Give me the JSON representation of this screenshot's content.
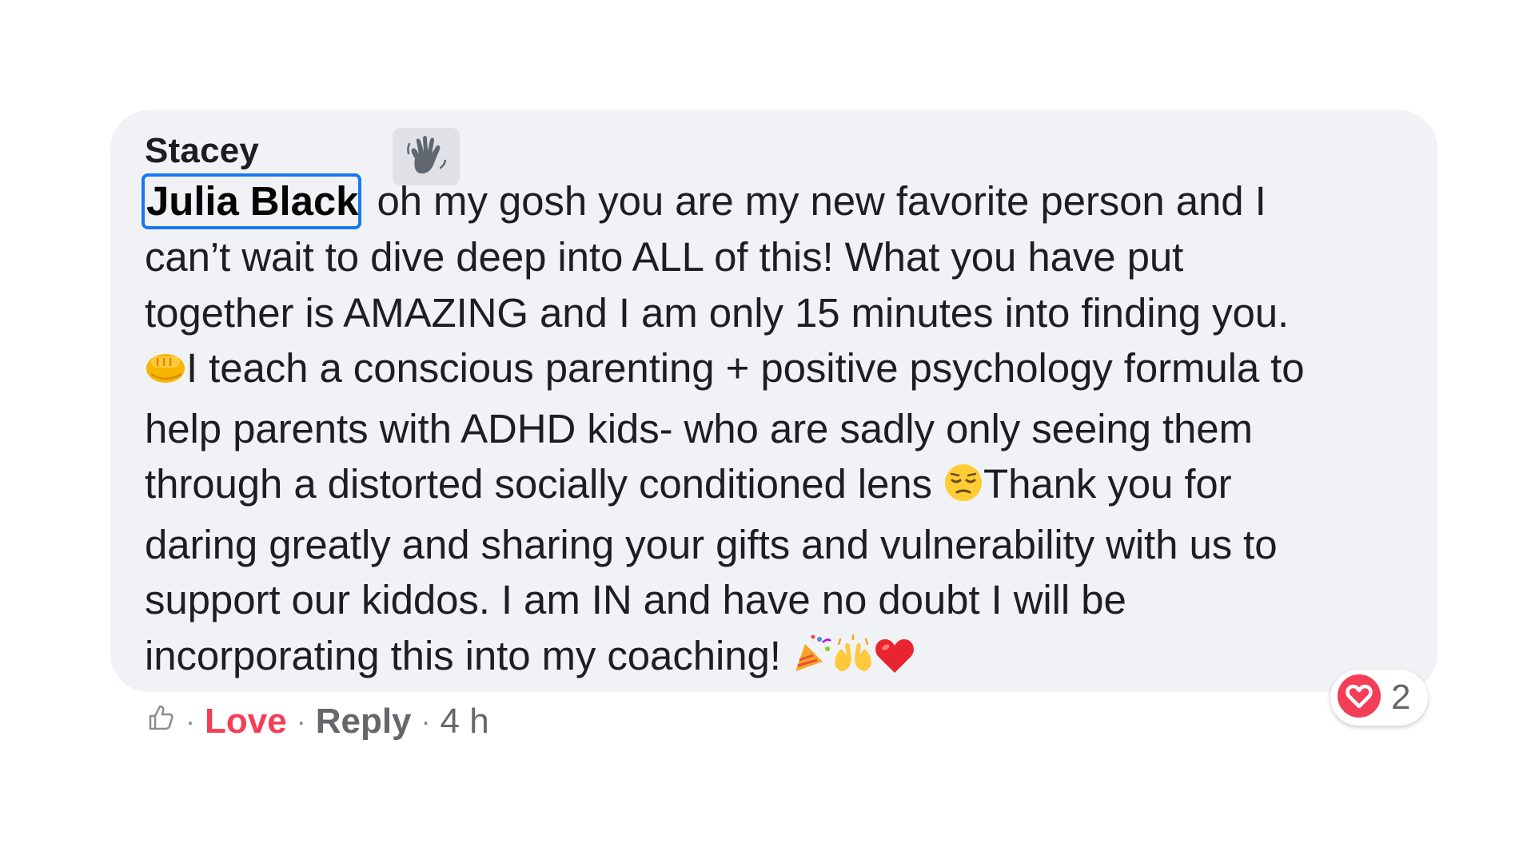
{
  "comment": {
    "author": "Stacey",
    "badge_icon": "wave-hand-icon",
    "mention": "Julia Black",
    "body_lines": [
      " oh my gosh you are my new favorite person and I",
      "can’t wait to dive deep into ALL of this! What you have put",
      "together is AMAZING and I am only 15 minutes into finding you.",
      "I teach a conscious parenting + positive psychology formula to",
      "help parents with ADHD kids- who are sadly only seeing them",
      "through a distorted socially conditioned lens ",
      "Thank you for",
      "daring greatly and sharing your gifts and vulnerability with us to",
      "support our kiddos. I am IN and have no doubt I will be",
      "incorporating this into my coaching! "
    ],
    "emojis": {
      "fist": "fist-bump-icon",
      "pensive": "pensive-face-icon",
      "party": "party-popper-icon",
      "raised_hands": "raised-hands-icon",
      "heart": "red-heart-icon"
    }
  },
  "actions": {
    "like_icon": "thumbs-up-outline-icon",
    "separator": "·",
    "love_label": "Love",
    "reply_label": "Reply",
    "timestamp": "4 h"
  },
  "reactions": {
    "icon": "love-reaction-icon",
    "count": "2"
  },
  "colors": {
    "bubble": "#f0f2f5",
    "mention_border": "#1877f2",
    "love": "#f33e58",
    "meta": "#65676b"
  }
}
